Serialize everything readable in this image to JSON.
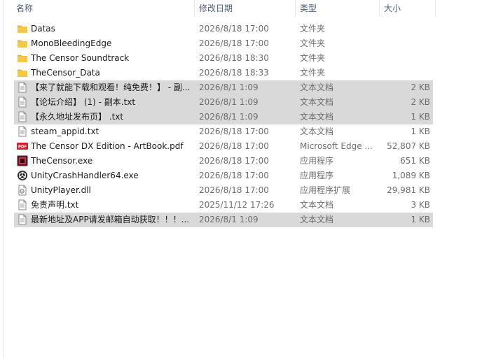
{
  "columns": {
    "name": "名称",
    "date": "修改日期",
    "type": "类型",
    "size": "大小"
  },
  "files": [
    {
      "name": "Datas",
      "date": "2026/8/18 17:00",
      "type": "文件夹",
      "size": "",
      "icon": "folder-icon",
      "selected": false
    },
    {
      "name": "MonoBleedingEdge",
      "date": "2026/8/18 17:00",
      "type": "文件夹",
      "size": "",
      "icon": "folder-icon",
      "selected": false
    },
    {
      "name": "The Censor Soundtrack",
      "date": "2026/8/18 18:30",
      "type": "文件夹",
      "size": "",
      "icon": "folder-icon",
      "selected": false
    },
    {
      "name": "TheCensor_Data",
      "date": "2026/8/18 18:33",
      "type": "文件夹",
      "size": "",
      "icon": "folder-icon",
      "selected": false
    },
    {
      "name": "【来了就能下载和观看！纯免费！】 - 副...",
      "date": "2026/8/1 1:09",
      "type": "文本文档",
      "size": "2 KB",
      "icon": "text-file-icon",
      "selected": true
    },
    {
      "name": "【论坛介绍】 (1) - 副本.txt",
      "date": "2026/8/1 1:09",
      "type": "文本文档",
      "size": "2 KB",
      "icon": "text-file-icon",
      "selected": true
    },
    {
      "name": "【永久地址发布页】 .txt",
      "date": "2026/8/1 1:09",
      "type": "文本文档",
      "size": "1 KB",
      "icon": "text-file-icon",
      "selected": true
    },
    {
      "name": "steam_appid.txt",
      "date": "2026/8/18 17:00",
      "type": "文本文档",
      "size": "1 KB",
      "icon": "text-file-icon",
      "selected": false
    },
    {
      "name": "The Censor DX Edition - ArtBook.pdf",
      "date": "2026/8/18 17:00",
      "type": "Microsoft Edge ...",
      "size": "52,807 KB",
      "icon": "pdf-icon",
      "selected": false
    },
    {
      "name": "TheCensor.exe",
      "date": "2026/8/18 17:00",
      "type": "应用程序",
      "size": "651 KB",
      "icon": "game-app-icon",
      "selected": false
    },
    {
      "name": "UnityCrashHandler64.exe",
      "date": "2026/8/18 17:00",
      "type": "应用程序",
      "size": "1,089 KB",
      "icon": "unity-icon",
      "selected": false
    },
    {
      "name": "UnityPlayer.dll",
      "date": "2026/8/18 17:00",
      "type": "应用程序扩展",
      "size": "29,981 KB",
      "icon": "dll-file-icon",
      "selected": false
    },
    {
      "name": "免责声明.txt",
      "date": "2025/11/12 17:26",
      "type": "文本文档",
      "size": "3 KB",
      "icon": "text-file-icon",
      "selected": false
    },
    {
      "name": "最新地址及APP请发邮箱自动获取！！！...",
      "date": "2026/8/1 1:09",
      "type": "文本文档",
      "size": "1 KB",
      "icon": "text-file-icon",
      "selected": true
    }
  ],
  "colors": {
    "selection": "#d9d9d9",
    "folder": "#f7c74a",
    "header_text": "#4c607a"
  }
}
